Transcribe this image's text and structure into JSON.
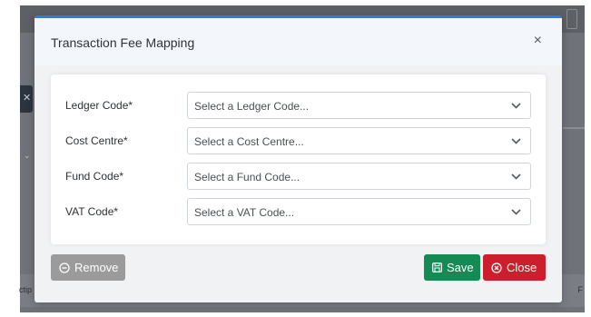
{
  "modal": {
    "title": "Transaction Fee Mapping",
    "close_symbol": "×"
  },
  "form": {
    "fields": [
      {
        "label": "Ledger Code*",
        "placeholder": "Select a Ledger Code..."
      },
      {
        "label": "Cost Centre*",
        "placeholder": "Select a Cost Centre..."
      },
      {
        "label": "Fund Code*",
        "placeholder": "Select a Fund Code..."
      },
      {
        "label": "VAT Code*",
        "placeholder": "Select a VAT Code..."
      }
    ]
  },
  "buttons": {
    "remove": {
      "label": "Remove",
      "icon": "minus-circle-icon"
    },
    "save": {
      "label": "Save",
      "icon": "floppy-disk-icon"
    },
    "close": {
      "label": "Close",
      "icon": "x-circle-icon"
    }
  },
  "background": {
    "left_text": "ctip",
    "right_text": "F"
  },
  "colors": {
    "accent": "#2e7fd9",
    "save": "#168a55",
    "close": "#cc1f2e",
    "remove": "#9b9b9b"
  }
}
